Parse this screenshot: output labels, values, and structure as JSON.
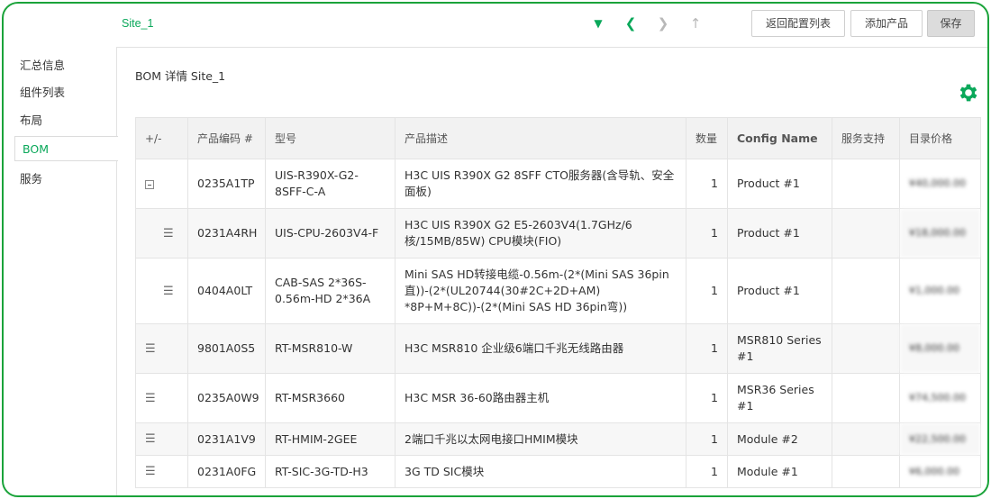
{
  "header": {
    "site_tab": "Site_1",
    "buttons": {
      "back": "返回配置列表",
      "add": "添加产品",
      "save": "保存"
    }
  },
  "sidebar": {
    "items": [
      {
        "label": "汇总信息"
      },
      {
        "label": "组件列表"
      },
      {
        "label": "布局"
      },
      {
        "label": "BOM"
      },
      {
        "label": "服务"
      }
    ],
    "active": "BOM"
  },
  "main": {
    "title": "BOM 详情 Site_1"
  },
  "table": {
    "headers": [
      "+/-",
      "产品编码 #",
      "型号",
      "产品描述",
      "数量",
      "Config Name",
      "服务支持",
      "目录价格"
    ],
    "rows": [
      {
        "code": "0235A1TP",
        "model": "UIS-R390X-G2-8SFF-C-A",
        "desc": "H3C UIS R390X G2 8SFF CTO服务器(含导轨、安全面板)",
        "qty": "1",
        "config": "Product #1",
        "service": "",
        "price": "¥40,000.00"
      },
      {
        "code": "0231A4RH",
        "model": "UIS-CPU-2603V4-F",
        "desc": "H3C UIS R390X G2 E5-2603V4(1.7GHz/6核/15MB/85W) CPU模块(FIO)",
        "qty": "1",
        "config": "Product #1",
        "service": "",
        "price": "¥18,000.00"
      },
      {
        "code": "0404A0LT",
        "model": "CAB-SAS 2*36S-0.56m-HD 2*36A",
        "desc": "Mini SAS HD转接电缆-0.56m-(2*(Mini SAS 36pin直))-(2*(UL20744(30#2C+2D+AM) *8P+M+8C))-(2*(Mini SAS HD 36pin弯))",
        "qty": "1",
        "config": "Product #1",
        "service": "",
        "price": "¥1,000.00"
      },
      {
        "code": "9801A0S5",
        "model": "RT-MSR810-W",
        "desc": "H3C MSR810 企业级6端口千兆无线路由器",
        "qty": "1",
        "config": "MSR810 Series #1",
        "service": "",
        "price": "¥8,000.00"
      },
      {
        "code": "0235A0W9",
        "model": "RT-MSR3660",
        "desc": "H3C MSR 36-60路由器主机",
        "qty": "1",
        "config": "MSR36 Series #1",
        "service": "",
        "price": "¥74,500.00"
      },
      {
        "code": "0231A1V9",
        "model": "RT-HMIM-2GEE",
        "desc": "2端口千兆以太网电接口HMIM模块",
        "qty": "1",
        "config": "Module #2",
        "service": "",
        "price": "¥22,500.00"
      },
      {
        "code": "0231A0FG",
        "model": "RT-SIC-3G-TD-H3",
        "desc": "3G TD SIC模块",
        "qty": "1",
        "config": "Module #1",
        "service": "",
        "price": "¥6,000.00"
      }
    ]
  },
  "colors": {
    "accent": "#0aa85a",
    "frame": "#1aa33a"
  }
}
